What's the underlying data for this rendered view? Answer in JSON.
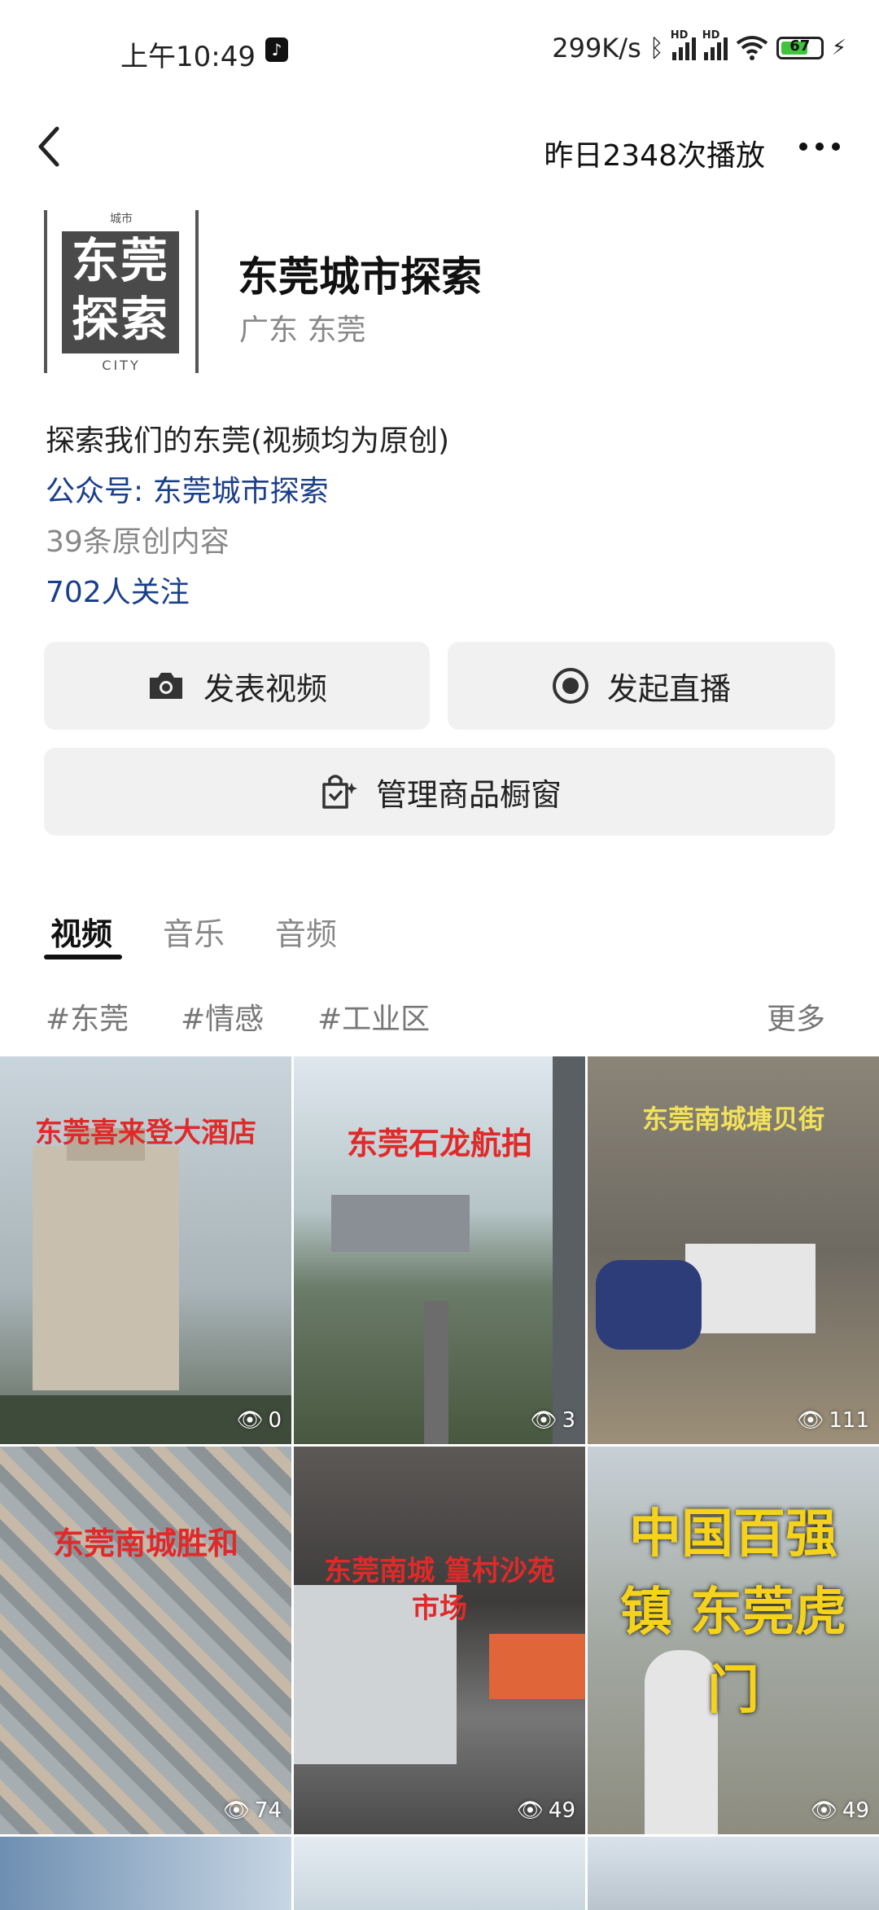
{
  "status": {
    "time": "上午10:49",
    "app_icon": "tiktok-icon",
    "speed": "299K/s",
    "network_label": "HD",
    "battery": "67"
  },
  "header": {
    "plays": "昨日2348次播放"
  },
  "profile": {
    "logo_top": "城市",
    "logo_line1": "东莞",
    "logo_line2": "探索",
    "logo_bottom": "CITY",
    "name": "东莞城市探索",
    "location": "广东 东莞",
    "bio": "探索我们的东莞(视频均为原创)",
    "official_account": "公众号: 东莞城市探索",
    "original_count": "39条原创内容",
    "followers": "702人关注"
  },
  "actions": {
    "publish_video": "发表视频",
    "start_live": "发起直播",
    "manage_shop": "管理商品橱窗"
  },
  "tabs": [
    {
      "label": "视频"
    },
    {
      "label": "音乐"
    },
    {
      "label": "音频"
    }
  ],
  "tags": [
    "#东莞",
    "#情感",
    "#工业区"
  ],
  "tags_more": "更多",
  "videos": [
    {
      "title": "东莞喜来登大酒店",
      "views": "0",
      "bg": "#b9c6cf",
      "color": "#e02a2a"
    },
    {
      "title": "东莞石龙航拍",
      "views": "3",
      "bg": "#7f8f86",
      "color": "#e02a2a"
    },
    {
      "title": "东莞南城塘贝街",
      "views": "111",
      "bg": "#8a7f6a",
      "color": "#f2e15a"
    },
    {
      "title": "东莞南城胜和",
      "views": "74",
      "bg": "#9aa3a6",
      "color": "#e02a2a"
    },
    {
      "title": "东莞南城 篁村沙苑市场",
      "views": "49",
      "bg": "#6d6a68",
      "color": "#e02a2a"
    },
    {
      "title": "中国百强镇 东莞虎门",
      "views": "49",
      "bg": "#a8aeb0",
      "color": "#f5d21b"
    }
  ]
}
